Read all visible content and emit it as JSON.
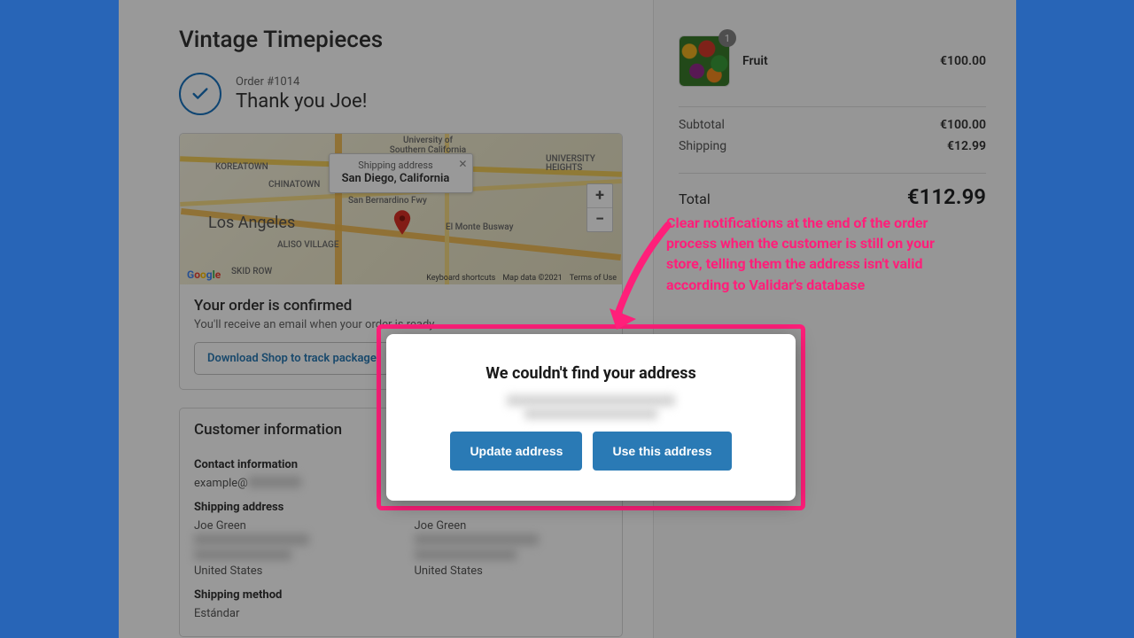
{
  "shop": {
    "name": "Vintage Timepieces"
  },
  "order": {
    "number_label": "Order #1014",
    "thank_you": "Thank you Joe!"
  },
  "map": {
    "tooltip_label": "Shipping address",
    "tooltip_location": "San Diego, California",
    "labels": {
      "la": "Los Angeles",
      "aliso": "ALISO VILLAGE",
      "chinatown": "CHINATOWN",
      "koreatown": "KOREATOWN",
      "skid": "SKID ROW",
      "usc": "University of Southern California",
      "univhts": "UNIVERSITY HEIGHTS",
      "busway": "El Monte Busway",
      "sanb": "San Bernardino Fwy"
    },
    "credits": {
      "shortcuts": "Keyboard shortcuts",
      "data": "Map data ©2021",
      "terms": "Terms of Use"
    }
  },
  "confirmed": {
    "heading": "Your order is confirmed",
    "sub": "You'll receive an email when your order is ready.",
    "download_button": "Download Shop to track package"
  },
  "customer": {
    "heading": "Customer information",
    "contact_h": "Contact information",
    "contact_email_prefix": "example@",
    "ship_addr_h": "Shipping address",
    "name": "Joe Green",
    "country": "United States",
    "bill_addr_name": "Joe Green",
    "ship_method_h": "Shipping method",
    "ship_method_v": "Estándar"
  },
  "cart": {
    "item": {
      "name": "Fruit",
      "qty": "1",
      "price": "€100.00"
    },
    "subtotal_k": "Subtotal",
    "subtotal_v": "€100.00",
    "shipping_k": "Shipping",
    "shipping_v": "€12.99",
    "total_k": "Total",
    "total_v": "€112.99"
  },
  "modal": {
    "title": "We couldn't find your address",
    "update_btn": "Update address",
    "use_btn": "Use this address"
  },
  "annotation": "Clear notifications at the end of the order process when the customer is still on your store, telling them the address isn't valid according to Validar's database",
  "colors": {
    "accent": "#2a7ab5",
    "highlight": "#ff1f7a"
  }
}
